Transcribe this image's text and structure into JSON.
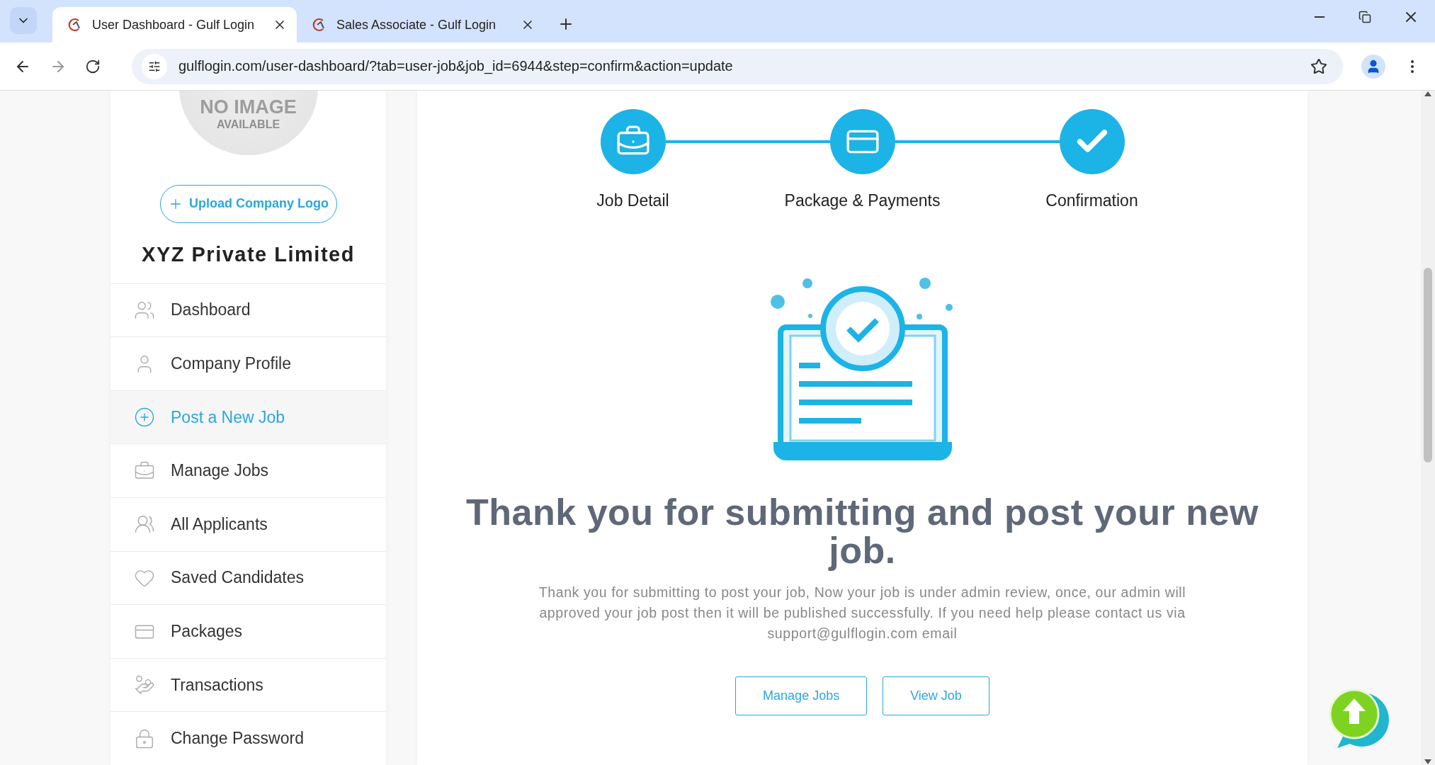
{
  "browser": {
    "tabs": [
      {
        "title": "User Dashboard - Gulf Login",
        "selected": true
      },
      {
        "title": "Sales Associate - Gulf Login",
        "selected": false
      }
    ],
    "url": "gulflogin.com/user-dashboard/?tab=user-job&job_id=6944&step=confirm&action=update"
  },
  "sidebar": {
    "no_image": {
      "line_1": "NO IMAGE",
      "line_2": "AVAILABLE"
    },
    "upload_button": "Upload Company Logo",
    "company_name": "XYZ Private Limited",
    "items": [
      {
        "label": "Dashboard",
        "selected": false
      },
      {
        "label": "Company Profile",
        "selected": false
      },
      {
        "label": "Post a New Job",
        "selected": true
      },
      {
        "label": "Manage Jobs",
        "selected": false
      },
      {
        "label": "All Applicants",
        "selected": false
      },
      {
        "label": "Saved Candidates",
        "selected": false
      },
      {
        "label": "Packages",
        "selected": false
      },
      {
        "label": "Transactions",
        "selected": false
      },
      {
        "label": "Change Password",
        "selected": false
      }
    ]
  },
  "steps": [
    {
      "label": "Job Detail"
    },
    {
      "label": "Package & Payments"
    },
    {
      "label": "Confirmation"
    }
  ],
  "heading": "Thank you for submitting and post your new job.",
  "message": "Thank you for submitting to post your job, Now your job is under admin review, once, our admin will approved your job post then it will be published successfully. If you need help please contact us via support@gulflogin.com email",
  "buttons": [
    "Manage Jobs",
    "View Job"
  ]
}
